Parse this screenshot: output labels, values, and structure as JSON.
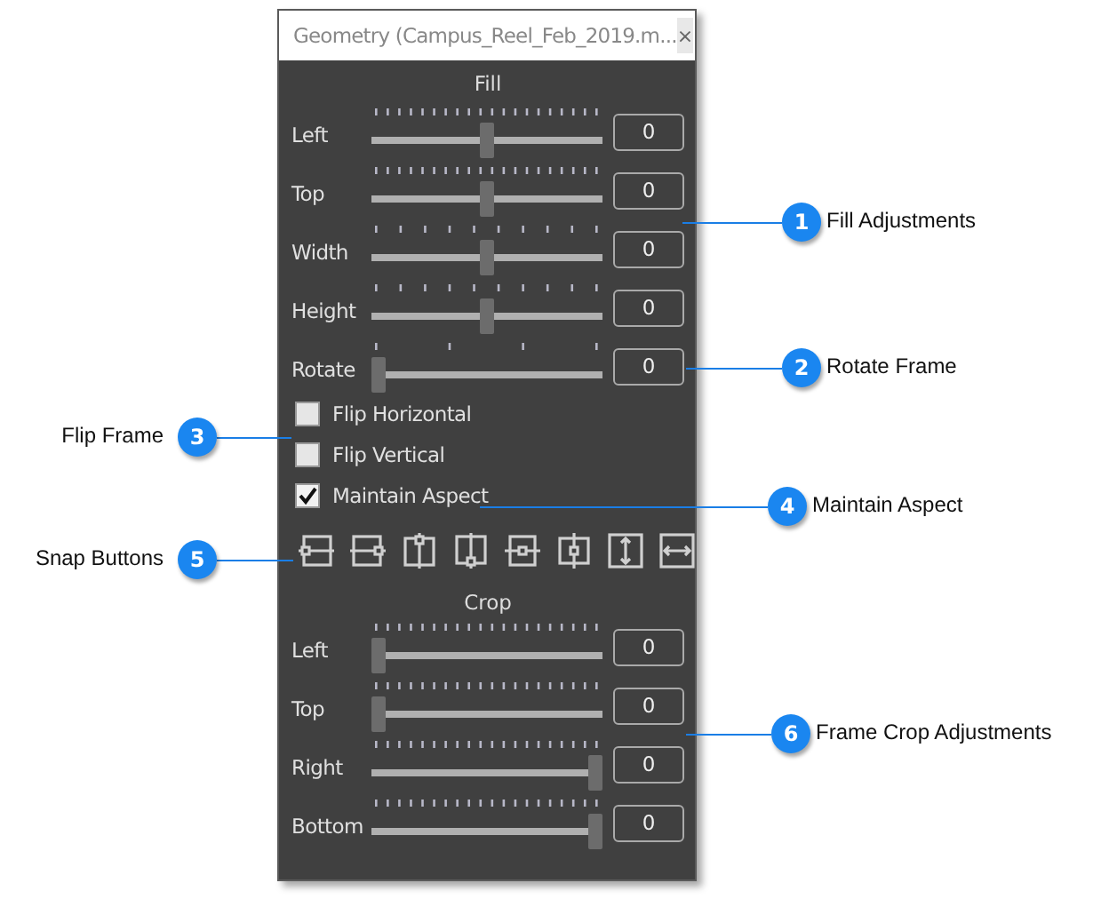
{
  "window": {
    "title": "Geometry (Campus_Reel_Feb_2019.m...",
    "close": "×"
  },
  "fill": {
    "heading": "Fill",
    "sliders": [
      {
        "label": "Left",
        "kind": "fine",
        "level": 0.5,
        "value": "0"
      },
      {
        "label": "Top",
        "kind": "fine",
        "level": 0.5,
        "value": "0"
      },
      {
        "label": "Width",
        "kind": "coarse",
        "level": 0.5,
        "value": "0"
      },
      {
        "label": "Height",
        "kind": "coarse",
        "level": 0.5,
        "value": "0"
      },
      {
        "label": "Rotate",
        "kind": "sparse",
        "level": 0,
        "value": "0"
      }
    ]
  },
  "options": [
    {
      "label": "Flip Horizontal",
      "checked": false
    },
    {
      "label": "Flip Vertical",
      "checked": false
    },
    {
      "label": "Maintain Aspect",
      "checked": true
    }
  ],
  "snap_buttons": [
    {
      "kind": "left"
    },
    {
      "kind": "right"
    },
    {
      "kind": "top"
    },
    {
      "kind": "bottom"
    },
    {
      "kind": "center_h"
    },
    {
      "kind": "center_v"
    },
    {
      "kind": "stretch_v"
    },
    {
      "kind": "stretch_h"
    }
  ],
  "crop": {
    "heading": "Crop",
    "sliders": [
      {
        "label": "Left",
        "kind": "fine",
        "level": 0,
        "value": "0"
      },
      {
        "label": "Top",
        "kind": "fine",
        "level": 0,
        "value": "0"
      },
      {
        "label": "Right",
        "kind": "fine",
        "level": 1,
        "value": "0"
      },
      {
        "label": "Bottom",
        "kind": "fine",
        "level": 1,
        "value": "0"
      }
    ]
  },
  "callouts": [
    {
      "number": "1",
      "label": "Fill Adjustments"
    },
    {
      "number": "2",
      "label": "Rotate Frame"
    },
    {
      "number": "3",
      "label": "Flip Frame"
    },
    {
      "number": "4",
      "label": "Maintain Aspect"
    },
    {
      "number": "5",
      "label": "Snap Buttons"
    },
    {
      "number": "6",
      "label": "Frame Crop Adjustments"
    }
  ]
}
